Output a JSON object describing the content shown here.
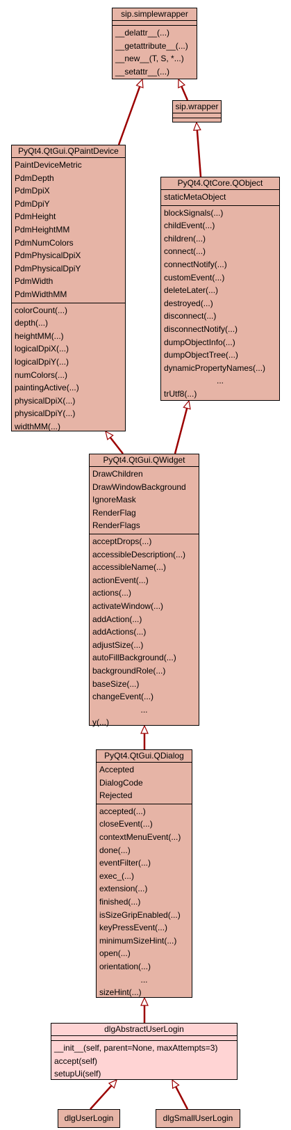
{
  "nodes": {
    "simplewrapper": {
      "title": "sip.simplewrapper",
      "methods": [
        "__delattr__(...)",
        "__getattribute__(...)",
        "__new__(T, S, *...)",
        "__setattr__(...)"
      ]
    },
    "wrapper": {
      "title": "sip.wrapper"
    },
    "qpaintdevice": {
      "title": "PyQt4.QtGui.QPaintDevice",
      "attributes": [
        "PaintDeviceMetric",
        "PdmDepth",
        "PdmDpiX",
        "PdmDpiY",
        "PdmHeight",
        "PdmHeightMM",
        "PdmNumColors",
        "PdmPhysicalDpiX",
        "PdmPhysicalDpiY",
        "PdmWidth",
        "PdmWidthMM"
      ],
      "methods": [
        "colorCount(...)",
        "depth(...)",
        "heightMM(...)",
        "logicalDpiX(...)",
        "logicalDpiY(...)",
        "numColors(...)",
        "paintingActive(...)",
        "physicalDpiX(...)",
        "physicalDpiY(...)",
        "widthMM(...)"
      ]
    },
    "qobject": {
      "title": "PyQt4.QtCore.QObject",
      "attributes": [
        "staticMetaObject"
      ],
      "methods": [
        "blockSignals(...)",
        "childEvent(...)",
        "children(...)",
        "connect(...)",
        "connectNotify(...)",
        "customEvent(...)",
        "deleteLater(...)",
        "destroyed(...)",
        "disconnect(...)",
        "disconnectNotify(...)",
        "dumpObjectInfo(...)",
        "dumpObjectTree(...)",
        "dynamicPropertyNames(...)",
        "..."
      ],
      "tail_methods": [
        "trUtf8(...)"
      ]
    },
    "qwidget": {
      "title": "PyQt4.QtGui.QWidget",
      "attributes": [
        "DrawChildren",
        "DrawWindowBackground",
        "IgnoreMask",
        "RenderFlag",
        "RenderFlags"
      ],
      "methods": [
        "acceptDrops(...)",
        "accessibleDescription(...)",
        "accessibleName(...)",
        "actionEvent(...)",
        "actions(...)",
        "activateWindow(...)",
        "addAction(...)",
        "addActions(...)",
        "adjustSize(...)",
        "autoFillBackground(...)",
        "backgroundRole(...)",
        "baseSize(...)",
        "changeEvent(...)",
        "..."
      ],
      "tail_methods": [
        "y(...)"
      ]
    },
    "qdialog": {
      "title": "PyQt4.QtGui.QDialog",
      "attributes": [
        "Accepted",
        "DialogCode",
        "Rejected"
      ],
      "methods": [
        "accepted(...)",
        "closeEvent(...)",
        "contextMenuEvent(...)",
        "done(...)",
        "eventFilter(...)",
        "exec_(...)",
        "extension(...)",
        "finished(...)",
        "isSizeGripEnabled(...)",
        "keyPressEvent(...)",
        "minimumSizeHint(...)",
        "open(...)",
        "orientation(...)",
        "..."
      ],
      "tail_methods": [
        "sizeHint(...)"
      ]
    },
    "dlgabstract": {
      "title": "dlgAbstractUserLogin",
      "methods": [
        "__init__(self, parent=None, maxAttempts=3)",
        "accept(self)",
        "setupUi(self)"
      ]
    },
    "dlguserlogin": {
      "title": "dlgUserLogin"
    },
    "dlgsmall": {
      "title": "dlgSmallUserLogin"
    }
  },
  "edges": [
    {
      "from": "wrapper",
      "to": "simplewrapper"
    },
    {
      "from": "qpaintdevice",
      "to": "simplewrapper"
    },
    {
      "from": "qobject",
      "to": "wrapper"
    },
    {
      "from": "qwidget",
      "to": "qpaintdevice"
    },
    {
      "from": "qwidget",
      "to": "qobject"
    },
    {
      "from": "qdialog",
      "to": "qwidget"
    },
    {
      "from": "dlgabstract",
      "to": "qdialog"
    },
    {
      "from": "dlguserlogin",
      "to": "dlgabstract"
    },
    {
      "from": "dlgsmall",
      "to": "dlgabstract"
    }
  ],
  "colors": {
    "node_fill": "#e6b4a6",
    "highlight_fill": "#ffd4d4",
    "edge": "#9b0000",
    "border": "#000000"
  }
}
